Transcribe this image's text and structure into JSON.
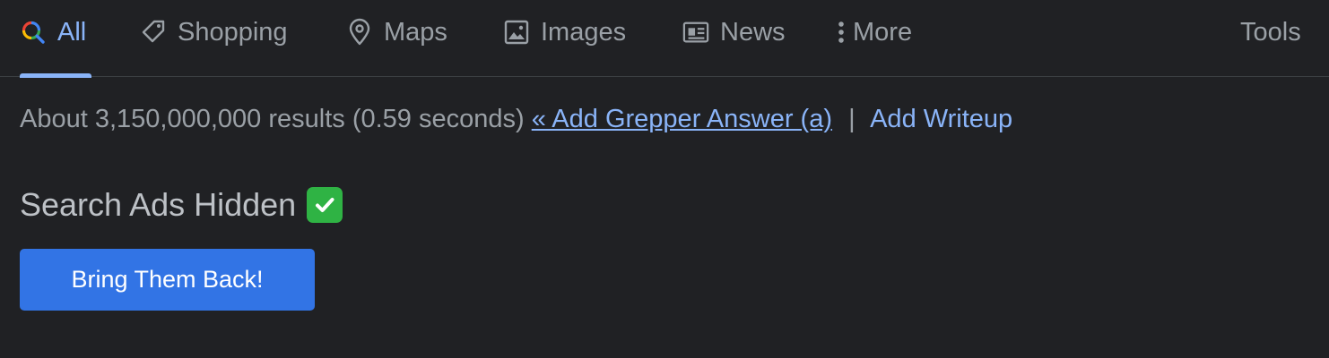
{
  "tabs": {
    "all": {
      "label": "All",
      "icon": "google-search-icon"
    },
    "shopping": {
      "label": "Shopping",
      "icon": "tag-icon"
    },
    "maps": {
      "label": "Maps",
      "icon": "map-pin-icon"
    },
    "images": {
      "label": "Images",
      "icon": "image-icon"
    },
    "news": {
      "label": "News",
      "icon": "newspaper-icon"
    },
    "more": {
      "label": "More",
      "icon": "vertical-dots-icon"
    },
    "tools": {
      "label": "Tools"
    }
  },
  "stats": {
    "text": "About 3,150,000,000 results (0.59 seconds)",
    "grepper_link": "« Add Grepper Answer (a)",
    "separator": "|",
    "writeup_link": "Add Writeup"
  },
  "ads": {
    "title": "Search Ads Hidden",
    "check_icon": "check-mark-icon",
    "button_label": "Bring Them Back!"
  },
  "colors": {
    "background": "#202124",
    "accent": "#8ab4f8",
    "text_muted": "#9aa0a6",
    "button": "#3274e5",
    "check": "#2fb344"
  }
}
